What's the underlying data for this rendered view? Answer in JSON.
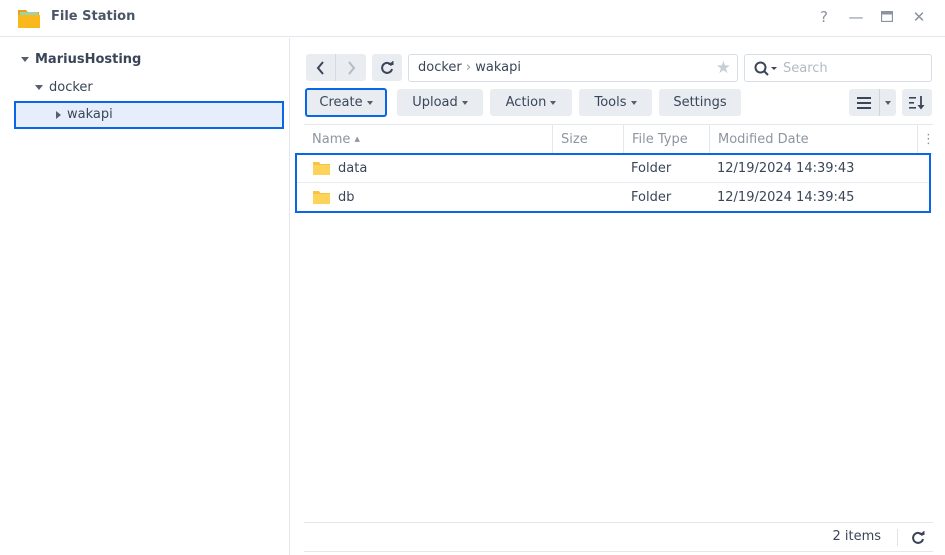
{
  "window": {
    "title": "File Station",
    "controls": {
      "help": "?",
      "minimize": "—",
      "maximize": "▭",
      "close": "✕"
    }
  },
  "sidebar": {
    "tree": [
      {
        "label": "MariusHosting",
        "level": 0,
        "expanded": true,
        "bold": true
      },
      {
        "label": "docker",
        "level": 1,
        "expanded": true
      },
      {
        "label": "wakapi",
        "level": 2,
        "expanded": false,
        "selected": true
      }
    ]
  },
  "navigation": {
    "breadcrumb": [
      "docker",
      "wakapi"
    ],
    "separator": "›",
    "search_placeholder": "Search"
  },
  "toolbar": {
    "buttons": [
      {
        "label": "Create",
        "dropdown": true,
        "focused": true
      },
      {
        "label": "Upload",
        "dropdown": true
      },
      {
        "label": "Action",
        "dropdown": true
      },
      {
        "label": "Tools",
        "dropdown": true
      },
      {
        "label": "Settings",
        "dropdown": false
      }
    ]
  },
  "file_list": {
    "columns": [
      "Name",
      "Size",
      "File Type",
      "Modified Date"
    ],
    "sort_indicator": "▲",
    "rows": [
      {
        "name": "data",
        "size": "",
        "type": "Folder",
        "modified": "12/19/2024 14:39:43"
      },
      {
        "name": "db",
        "size": "",
        "type": "Folder",
        "modified": "12/19/2024 14:39:45"
      }
    ]
  },
  "footer": {
    "item_count": "2 items"
  },
  "colors": {
    "accent": "#0a66e8",
    "selected_bg": "#e5eefa",
    "folder": "#f6c343"
  }
}
